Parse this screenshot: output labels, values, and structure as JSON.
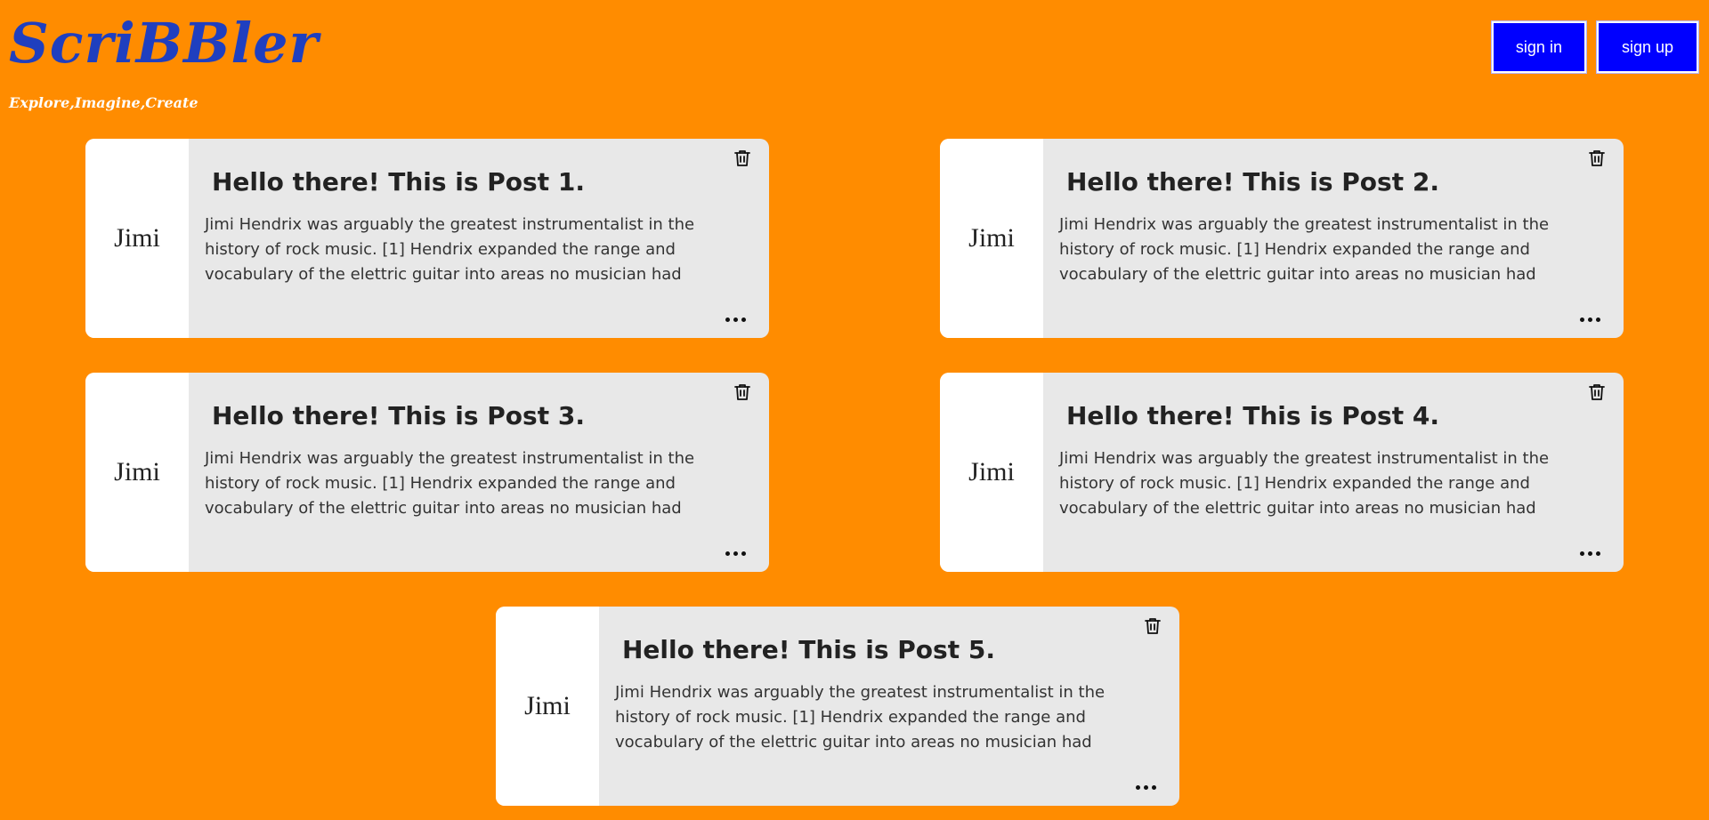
{
  "brand": {
    "name": "ScriBBler",
    "tagline": "Explore,Imagine,Create"
  },
  "auth": {
    "signin_label": "sign in",
    "signup_label": "sign up"
  },
  "posts": [
    {
      "author": "Jimi",
      "title": "Hello there! This is Post 1.",
      "excerpt": "Jimi Hendrix was arguably the greatest instrumentalist in the history of rock music. [1] Hendrix expanded the range and vocabulary of the elettric guitar into areas no musician had"
    },
    {
      "author": "Jimi",
      "title": "Hello there! This is Post 2.",
      "excerpt": "Jimi Hendrix was arguably the greatest instrumentalist in the history of rock music. [1] Hendrix expanded the range and vocabulary of the elettric guitar into areas no musician had"
    },
    {
      "author": "Jimi",
      "title": "Hello there! This is Post 3.",
      "excerpt": "Jimi Hendrix was arguably the greatest instrumentalist in the history of rock music. [1] Hendrix expanded the range and vocabulary of the elettric guitar into areas no musician had"
    },
    {
      "author": "Jimi",
      "title": "Hello there! This is Post 4.",
      "excerpt": "Jimi Hendrix was arguably the greatest instrumentalist in the history of rock music. [1] Hendrix expanded the range and vocabulary of the elettric guitar into areas no musician had"
    },
    {
      "author": "Jimi",
      "title": "Hello there! This is Post 5.",
      "excerpt": "Jimi Hendrix was arguably the greatest instrumentalist in the history of rock music. [1] Hendrix expanded the range and vocabulary of the elettric guitar into areas no musician had"
    }
  ],
  "colors": {
    "background": "#ff8c00",
    "logo": "#1f3fbf",
    "button": "#0000ff",
    "card": "#e8e8e8",
    "author_panel": "#ffffff"
  },
  "icons": {
    "delete": "trash-icon",
    "menu": "more-options-icon"
  }
}
